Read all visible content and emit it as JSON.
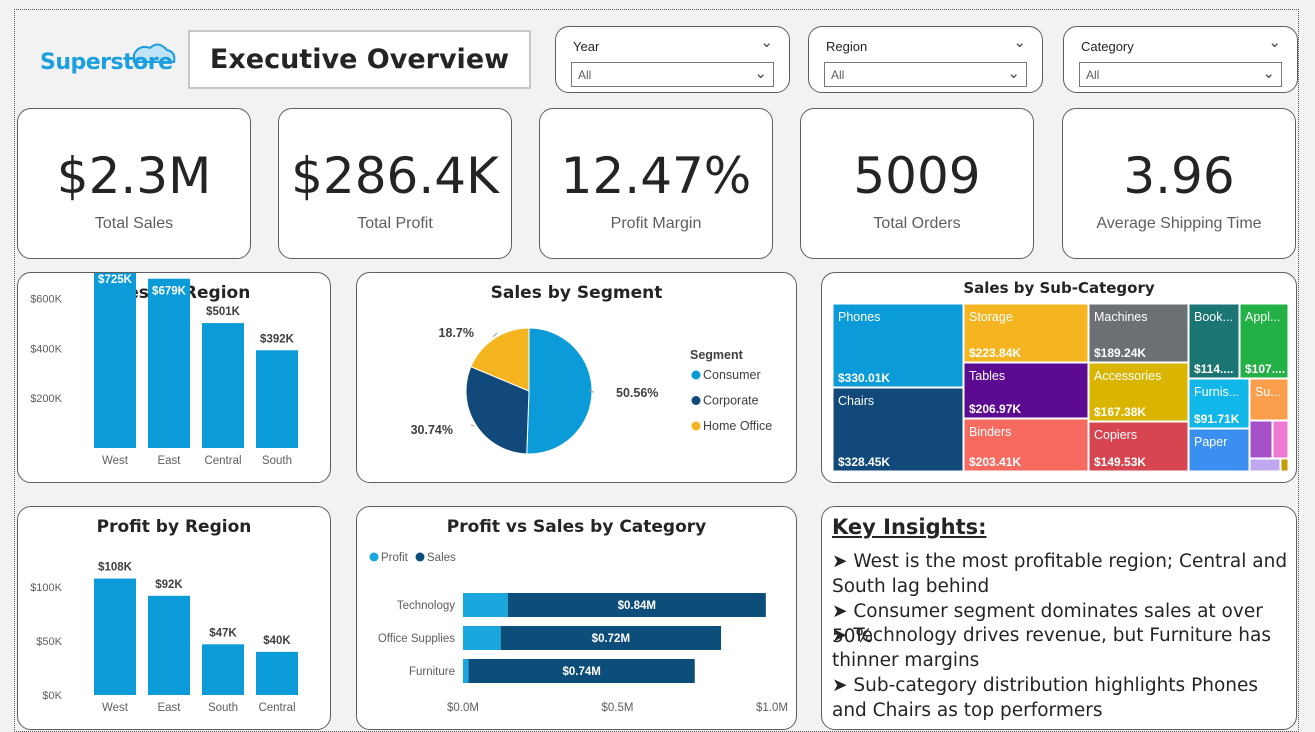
{
  "header": {
    "logo_text": "Superstore",
    "title": "Executive Overview"
  },
  "slicers": [
    {
      "label": "Year",
      "value": "All"
    },
    {
      "label": "Region",
      "value": "All"
    },
    {
      "label": "Category",
      "value": "All"
    }
  ],
  "kpis": [
    {
      "value": "$2.3M",
      "label": "Total Sales"
    },
    {
      "value": "$286.4K",
      "label": "Total Profit"
    },
    {
      "value": "12.47%",
      "label": "Profit Margin"
    },
    {
      "value": "5009",
      "label": "Total Orders"
    },
    {
      "value": "3.96",
      "label": "Average Shipping Time"
    }
  ],
  "colors": {
    "bar_blue": "#0a9bd8",
    "consumer": "#0a9bd8",
    "corporate": "#10497a",
    "home_office": "#f5b520",
    "profit_light": "#1aa7dd",
    "sales_dark": "#0d4d79"
  },
  "chart_data": [
    {
      "id": "sales_by_region",
      "type": "bar",
      "title": "Sales by Region",
      "categories": [
        "West",
        "East",
        "Central",
        "South"
      ],
      "values": [
        725,
        679,
        501,
        392
      ],
      "value_unit": "K$",
      "data_labels": [
        "$725K",
        "$679K",
        "$501K",
        "$392K"
      ],
      "yticks": [
        "$200K",
        "$400K",
        "$600K"
      ],
      "ytick_values": [
        200,
        400,
        600
      ],
      "ylim": [
        0,
        750
      ]
    },
    {
      "id": "sales_by_segment",
      "type": "pie",
      "title": "Sales by Segment",
      "legend_title": "Segment",
      "slices": [
        {
          "name": "Consumer",
          "value": 50.56,
          "label": "50.56%"
        },
        {
          "name": "Corporate",
          "value": 30.74,
          "label": "30.74%"
        },
        {
          "name": "Home Office",
          "value": 18.7,
          "label": "18.7%"
        }
      ]
    },
    {
      "id": "sales_by_subcategory",
      "type": "treemap",
      "title": "Sales by Sub-Category",
      "items": [
        {
          "name": "Phones",
          "label": "$330.01K"
        },
        {
          "name": "Chairs",
          "label": "$328.45K"
        },
        {
          "name": "Storage",
          "label": "$223.84K"
        },
        {
          "name": "Tables",
          "label": "$206.97K"
        },
        {
          "name": "Binders",
          "label": "$203.41K"
        },
        {
          "name": "Machines",
          "label": "$189.24K"
        },
        {
          "name": "Accessories",
          "label": "$167.38K"
        },
        {
          "name": "Copiers",
          "label": "$149.53K"
        },
        {
          "name": "Book...",
          "label": "$114...."
        },
        {
          "name": "Appl...",
          "label": "$107...."
        },
        {
          "name": "Furnis...",
          "label": "$91.71K"
        },
        {
          "name": "Su...",
          "label": ""
        },
        {
          "name": "Paper",
          "label": ""
        }
      ]
    },
    {
      "id": "profit_by_region",
      "type": "bar",
      "title": "Profit by Region",
      "categories": [
        "West",
        "East",
        "South",
        "Central"
      ],
      "values": [
        108,
        92,
        47,
        40
      ],
      "value_unit": "K$",
      "data_labels": [
        "$108K",
        "$92K",
        "$47K",
        "$40K"
      ],
      "yticks": [
        "$0K",
        "$50K",
        "$100K"
      ],
      "ytick_values": [
        0,
        50,
        100
      ],
      "ylim": [
        0,
        115
      ]
    },
    {
      "id": "profit_vs_sales_by_category",
      "type": "bar",
      "orientation": "horizontal",
      "stacked": true,
      "title": "Profit vs Sales by Category",
      "categories": [
        "Technology",
        "Office Supplies",
        "Furniture"
      ],
      "series": [
        {
          "name": "Profit",
          "values": [
            0.145,
            0.122,
            0.018
          ]
        },
        {
          "name": "Sales",
          "values": [
            0.84,
            0.72,
            0.74
          ]
        }
      ],
      "data_labels": [
        "$0.84M",
        "$0.72M",
        "$0.74M"
      ],
      "xticks": [
        "$0.0M",
        "$0.5M",
        "$1.0M"
      ],
      "xtick_values": [
        0,
        0.5,
        1.0
      ],
      "xlim": [
        0,
        1.0
      ]
    }
  ],
  "insights": {
    "title": "Key Insights:",
    "items": [
      "➤ West is the most profitable region; Central and South lag behind",
      "➤ Consumer segment dominates sales at over 50%",
      "➤ Technology drives revenue, but Furniture has thinner margins",
      "➤ Sub-category distribution highlights Phones and Chairs as top performers"
    ]
  }
}
